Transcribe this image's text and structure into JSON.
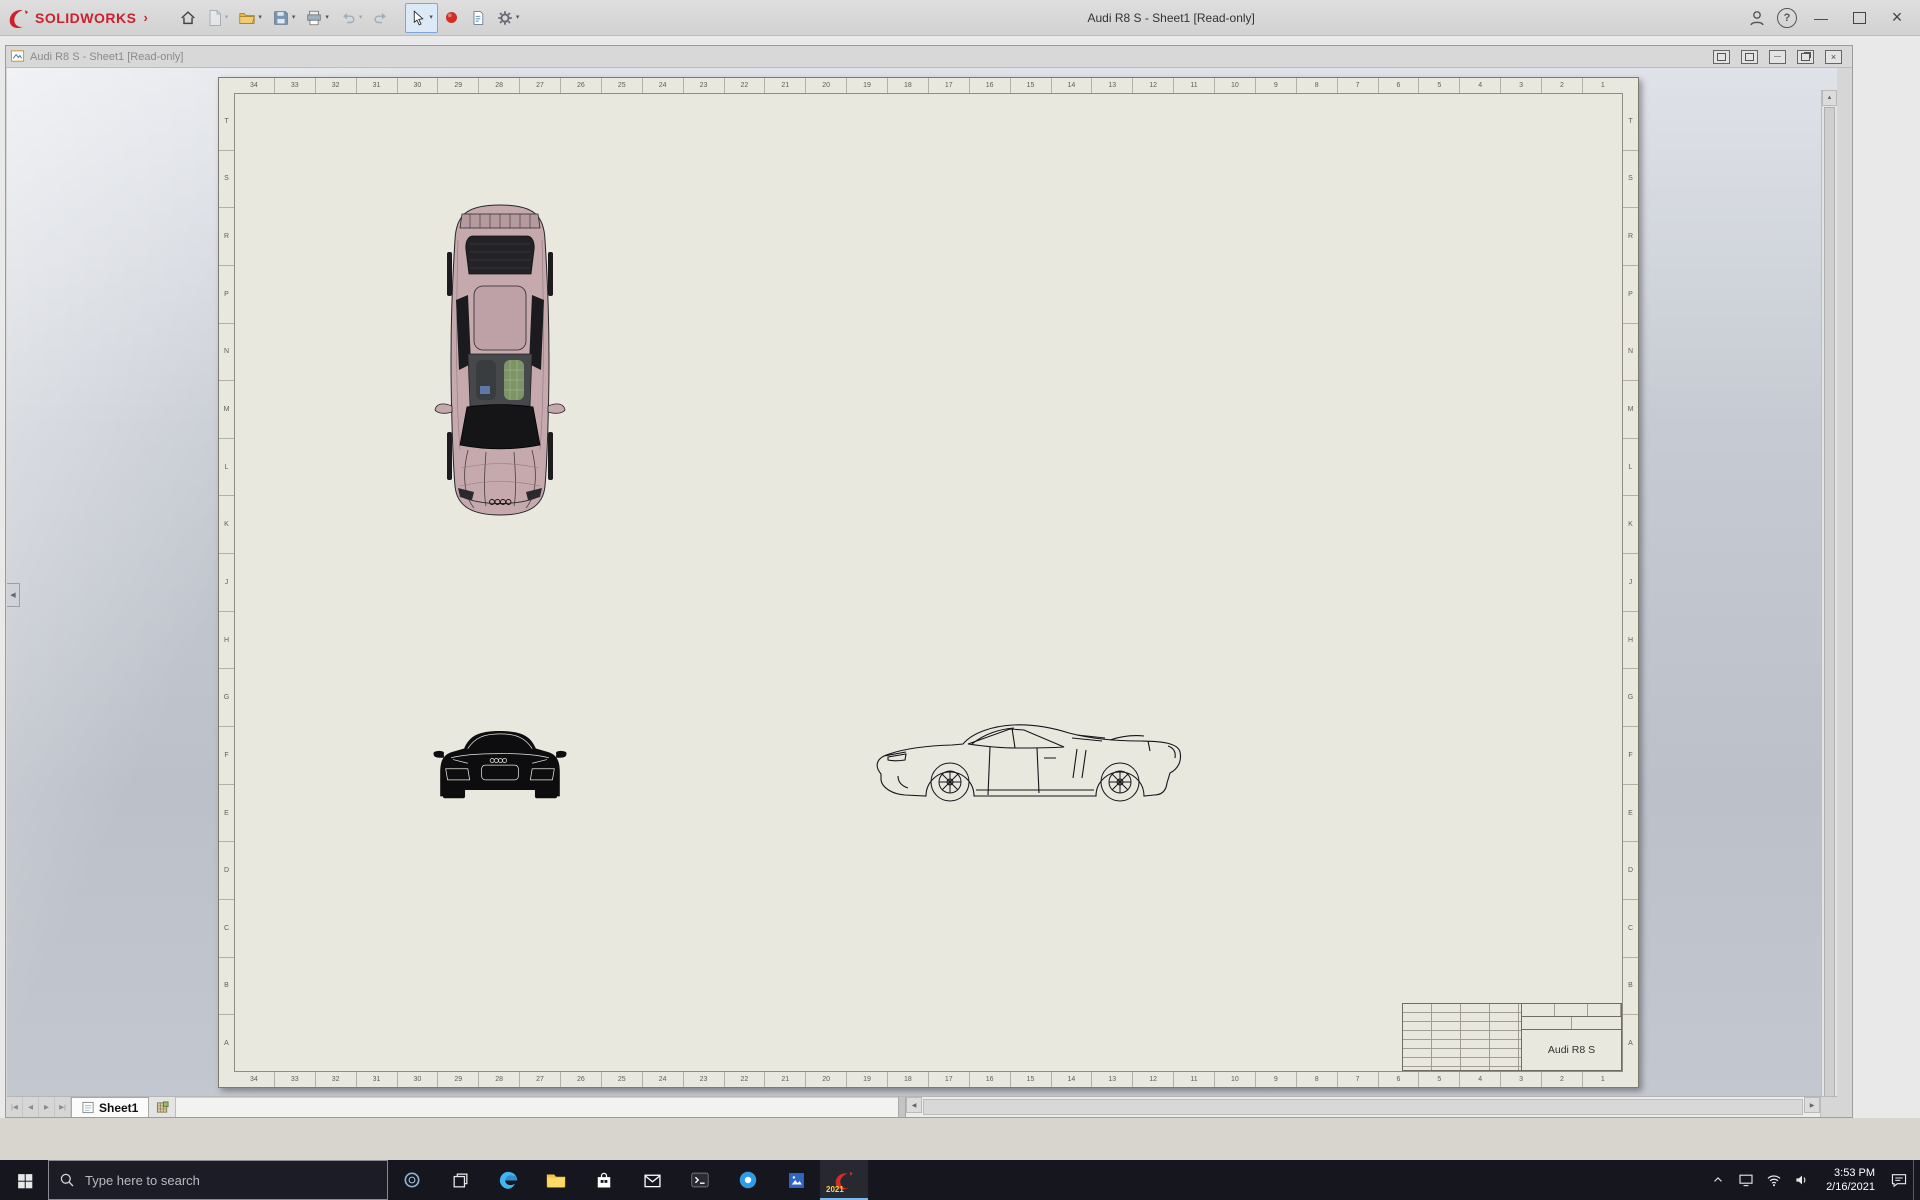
{
  "colors": {
    "brand_red": "#cf1f2c",
    "car_body": "#c6a9ad",
    "taskbar_bg": "#16161f",
    "active_accent": "#76b9ed"
  },
  "glyphs": {
    "brand_chevron": "›",
    "caret": "▾",
    "help": "?",
    "minimize": "—",
    "close": "×",
    "nav_first": "|◀",
    "nav_prev": "◀",
    "nav_next": "▶",
    "nav_last": "▶|",
    "scroll_left": "◀",
    "scroll_right": "▶",
    "scroll_up": "▲",
    "scroll_down": "▼",
    "collapse_left": "◀"
  },
  "app_titlebar": {
    "brand": "SOLIDWORKS",
    "title": "Audi R8 S - Sheet1 [Read-only]"
  },
  "document_window": {
    "title": "Audi R8 S - Sheet1 [Read-only]"
  },
  "sheet": {
    "zone_numbers": [
      "34",
      "33",
      "32",
      "31",
      "30",
      "29",
      "28",
      "27",
      "26",
      "25",
      "24",
      "23",
      "22",
      "21",
      "20",
      "19",
      "18",
      "17",
      "16",
      "15",
      "14",
      "13",
      "12",
      "11",
      "10",
      "9",
      "8",
      "7",
      "6",
      "5",
      "4",
      "3",
      "2",
      "1"
    ],
    "zone_letters": [
      "T",
      "S",
      "R",
      "P",
      "N",
      "M",
      "L",
      "K",
      "J",
      "H",
      "G",
      "F",
      "E",
      "D",
      "C",
      "B",
      "A"
    ],
    "title_block": {
      "model_name": "Audi R8 S"
    }
  },
  "sheet_tabs": {
    "active": "Sheet1"
  },
  "taskbar": {
    "search_placeholder": "Type here to search",
    "solidworks_badge": "2021",
    "time": "3:53 PM",
    "date": "2/16/2021"
  }
}
